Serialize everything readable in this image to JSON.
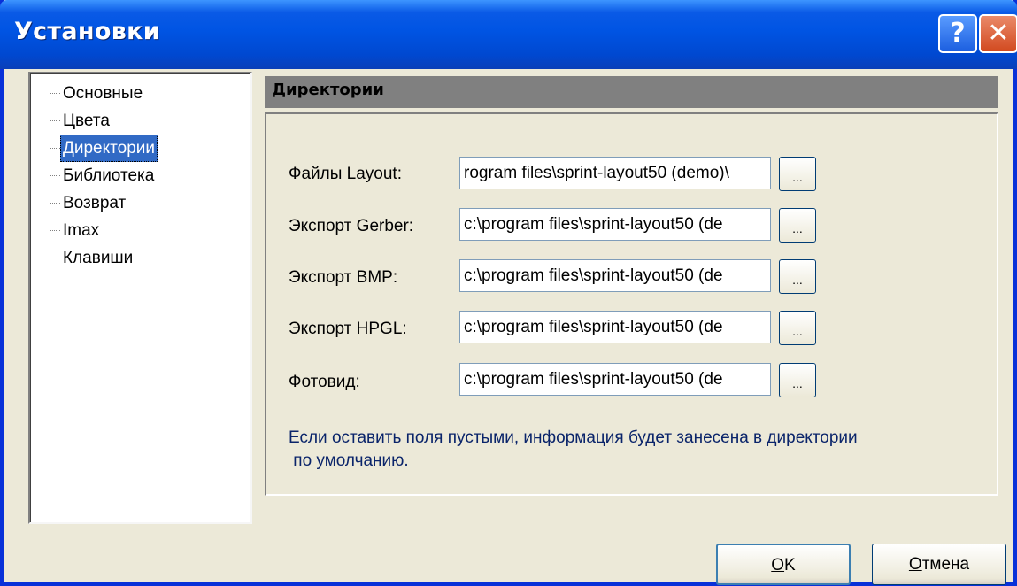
{
  "window": {
    "title": "Установки",
    "help_glyph": "?",
    "close_glyph": "✕"
  },
  "tree": {
    "items": [
      {
        "label": "Основные",
        "selected": false
      },
      {
        "label": "Цвета",
        "selected": false
      },
      {
        "label": "Директории",
        "selected": true
      },
      {
        "label": "Библиотека",
        "selected": false
      },
      {
        "label": "Возврат",
        "selected": false
      },
      {
        "label": "Imax",
        "selected": false
      },
      {
        "label": "Клавиши",
        "selected": false
      }
    ]
  },
  "section": {
    "title": "Директории"
  },
  "rows": [
    {
      "label": "Файлы Layout:",
      "value": "rogram files\\sprint-layout50 (demo)\\",
      "button": "..."
    },
    {
      "label": "Экспорт Gerber:",
      "value": "c:\\program files\\sprint-layout50 (de",
      "button": "..."
    },
    {
      "label": "Экспорт BMP:",
      "value": "c:\\program files\\sprint-layout50 (de",
      "button": "..."
    },
    {
      "label": "Экспорт HPGL:",
      "value": "c:\\program files\\sprint-layout50 (de",
      "button": "..."
    },
    {
      "label": "Фотовид:",
      "value": "c:\\program files\\sprint-layout50 (de",
      "button": "..."
    }
  ],
  "info": {
    "line1": "Если оставить поля пустыми, информация будет занесена в директории",
    "line2": " по умолчанию."
  },
  "buttons": {
    "ok_mnemonic": "O",
    "ok_rest": "K",
    "cancel_mnemonic": "О",
    "cancel_rest": "тмена"
  },
  "colors": {
    "titlebar": "#0054e3",
    "selection": "#316ac5",
    "info_text": "#0a246a",
    "dialog_bg": "#ece9d8"
  }
}
